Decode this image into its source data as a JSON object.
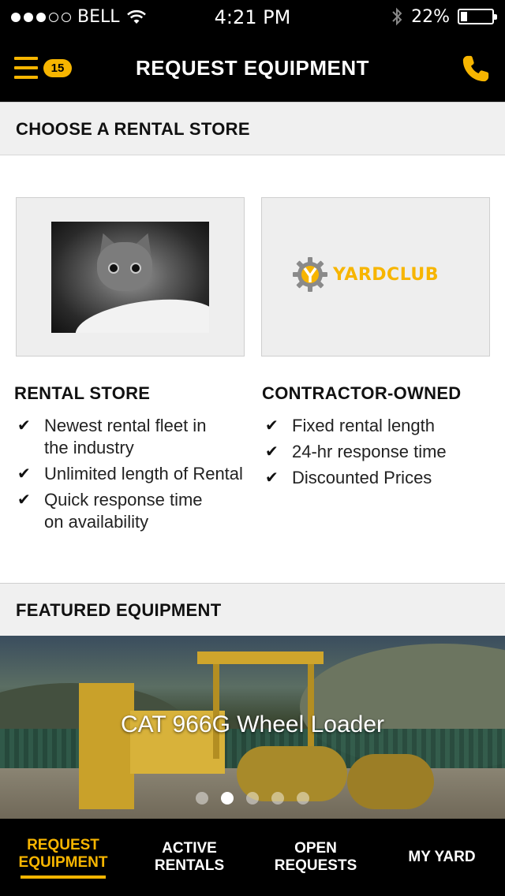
{
  "status_bar": {
    "carrier": "BELL",
    "time": "4:21 PM",
    "battery_percent": "22%",
    "battery_level": 0.22,
    "signal_bars_filled": 3,
    "signal_bars_total": 5,
    "icons": [
      "wifi-icon",
      "bluetooth-icon",
      "battery-icon"
    ]
  },
  "header": {
    "title": "REQUEST EQUIPMENT",
    "badge_count": "15",
    "accent_color": "#f7b500"
  },
  "rental_section": {
    "heading": "CHOOSE A RENTAL STORE",
    "stores": [
      {
        "title": "RENTAL STORE",
        "image": "kitten-photo",
        "features": [
          "Newest rental fleet in\nthe industry",
          "Unlimited length of Rental",
          "Quick response time\non availability"
        ]
      },
      {
        "title": "CONTRACTOR-OWNED",
        "image": "yardclub-logo",
        "logo_text": "YARDCLUB",
        "features": [
          "Fixed rental length",
          "24-hr response time",
          "Discounted Prices"
        ]
      }
    ]
  },
  "featured_section": {
    "heading": "FEATURED EQUIPMENT",
    "current_item": "CAT 966G Wheel Loader",
    "page_count": 5,
    "active_page": 2
  },
  "tab_bar": {
    "tabs": [
      {
        "label": "REQUEST\nEQUIPMENT",
        "active": true
      },
      {
        "label": "ACTIVE\nRENTALS",
        "active": false
      },
      {
        "label": "OPEN\nREQUESTS",
        "active": false
      },
      {
        "label": "MY YARD",
        "active": false
      }
    ]
  }
}
